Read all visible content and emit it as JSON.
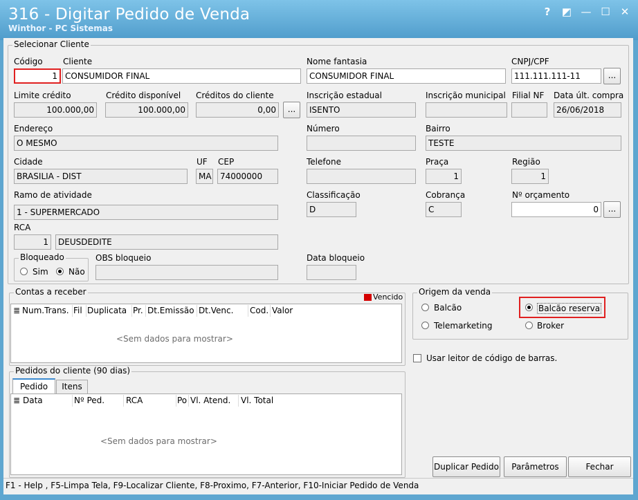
{
  "window": {
    "title": "316 - Digitar Pedido de Venda",
    "subtitle": "Winthor - PC Sistemas",
    "controls": {
      "help": "?",
      "restore": "◩",
      "minimize": "—",
      "maximize": "☐",
      "close": "✕"
    }
  },
  "cliente": {
    "group_label": "Selecionar Cliente",
    "codigo": {
      "label": "Código",
      "value": "1"
    },
    "cliente": {
      "label": "Cliente",
      "value": "CONSUMIDOR FINAL"
    },
    "nome_fantasia": {
      "label": "Nome fantasia",
      "value": "CONSUMIDOR FINAL"
    },
    "cnpj": {
      "label": "CNPJ/CPF",
      "value": "111.111.111-11"
    },
    "limite_credito": {
      "label": "Limite crédito",
      "value": "100.000,00"
    },
    "credito_disponivel": {
      "label": "Crédito disponível",
      "value": "100.000,00"
    },
    "creditos_cliente": {
      "label": "Créditos do cliente",
      "value": "0,00"
    },
    "inscricao_estadual": {
      "label": "Inscrição estadual",
      "value": "ISENTO"
    },
    "inscricao_municipal": {
      "label": "Inscrição municipal",
      "value": ""
    },
    "filial_nf": {
      "label": "Filial NF",
      "value": ""
    },
    "data_ult_compra": {
      "label": "Data últ. compra",
      "value": "26/06/2018"
    },
    "endereco": {
      "label": "Endereço",
      "value": "O MESMO"
    },
    "numero": {
      "label": "Número",
      "value": ""
    },
    "bairro": {
      "label": "Bairro",
      "value": "TESTE"
    },
    "cidade": {
      "label": "Cidade",
      "value": "BRASILIA - DIST"
    },
    "uf": {
      "label": "UF",
      "value": "MA"
    },
    "cep": {
      "label": "CEP",
      "value": "74000000"
    },
    "telefone": {
      "label": "Telefone",
      "value": ""
    },
    "praca": {
      "label": "Praça",
      "value": "1"
    },
    "regiao": {
      "label": "Região",
      "value": "1"
    },
    "ramo": {
      "label": "Ramo de atividade",
      "value": "1 - SUPERMERCADO"
    },
    "classificacao": {
      "label": "Classificação",
      "value": "D"
    },
    "cobranca": {
      "label": "Cobrança",
      "value": "C"
    },
    "orcamento": {
      "label": "Nº orçamento",
      "value": "0"
    },
    "rca": {
      "label": "RCA",
      "code": "1",
      "name": "DEUSDEDITE"
    },
    "bloqueado": {
      "label": "Bloqueado",
      "sim": "Sim",
      "nao": "Não"
    },
    "obs_bloqueio": {
      "label": "OBS bloqueio",
      "value": ""
    },
    "data_bloqueio": {
      "label": "Data bloqueio",
      "value": ""
    },
    "ellipsis": "..."
  },
  "contas": {
    "group_label": "Contas a receber",
    "legend": "Vencido",
    "legend_color": "#d40000",
    "columns": [
      "Num.Trans.",
      "Fil",
      "Duplicata",
      "Pr.",
      "Dt.Emissão",
      "Dt.Venc.",
      "Cod.",
      "Valor"
    ],
    "empty": "<Sem dados para mostrar>"
  },
  "origem": {
    "group_label": "Origem da venda",
    "options": [
      "Balcão",
      "Balcão reserva",
      "Telemarketing",
      "Broker"
    ],
    "selected": "Balcão reserva"
  },
  "barcode": {
    "label": "Usar leitor de código de barras."
  },
  "pedidos": {
    "group_label": "Pedidos do cliente (90 dias)",
    "tabs": [
      "Pedido",
      "Itens"
    ],
    "columns": [
      "Data",
      "Nº Ped.",
      "RCA",
      "Po",
      "Vl. Atend.",
      "Vl. Total"
    ],
    "empty": "<Sem dados para mostrar>"
  },
  "buttons": {
    "duplicar": "Duplicar Pedido",
    "parametros": "Parâmetros",
    "fechar": "Fechar"
  },
  "status": "F1 - Help , F5-Limpa Tela, F9-Localizar Cliente, F8-Proximo, F7-Anterior, F10-Iniciar Pedido de Venda",
  "colors": {
    "title_bar": "#5ea6d0",
    "highlight": "#e02020",
    "panel": "#f0f0f0"
  }
}
